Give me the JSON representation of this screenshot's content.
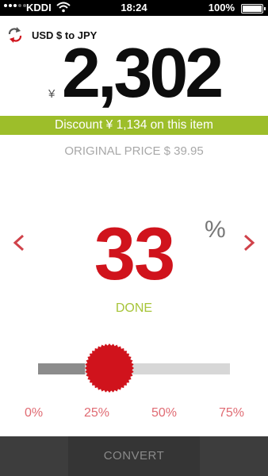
{
  "status_bar": {
    "carrier": "KDDI",
    "time": "18:24",
    "battery": "100%"
  },
  "header": {
    "currency_pair": "USD $ to JPY",
    "currency_symbol": "¥",
    "price": "2,302"
  },
  "discount_banner": "Discount ¥ 1,134 on this item",
  "original_price": "ORIGINAL PRICE $ 39.95",
  "percent_picker": {
    "value": "33",
    "symbol": "%",
    "done_label": "DONE"
  },
  "slider": {
    "level_fraction": 0.33,
    "ticks": [
      "0%",
      "25%",
      "50%",
      "75%"
    ]
  },
  "bottom_bar": {
    "convert_label": "CONVERT"
  },
  "colors": {
    "accent_red": "#d0131c",
    "accent_green": "#9dbe2a",
    "tick_red": "#e06b73"
  }
}
